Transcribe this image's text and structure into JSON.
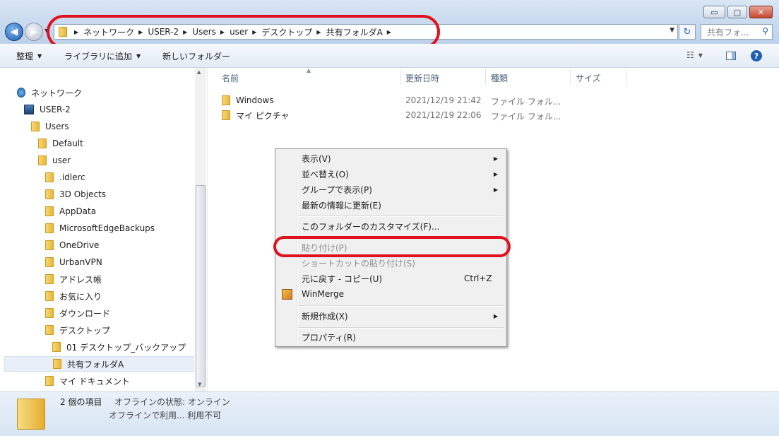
{
  "window": {
    "controls": {
      "minimize": "▭",
      "maximize": "□",
      "close": "✕"
    }
  },
  "address": {
    "breadcrumbs": [
      "ネットワーク",
      "USER-2",
      "Users",
      "user",
      "デスクトップ",
      "共有フォルダA"
    ],
    "search_placeholder": "共有フォ..."
  },
  "toolbar": {
    "organize": "整理",
    "add_to_library": "ライブラリに追加",
    "new_folder": "新しいフォルダー"
  },
  "sidebar": {
    "items": [
      {
        "label": "ネットワーク",
        "icon": "network-icon"
      },
      {
        "label": "USER-2",
        "icon": "computer-icon"
      },
      {
        "label": "Users",
        "icon": "user-folder-icon"
      },
      {
        "label": "Default",
        "icon": "folder-icon"
      },
      {
        "label": "user",
        "icon": "folder-icon"
      },
      {
        "label": ".idlerc",
        "icon": "folder-icon"
      },
      {
        "label": "3D Objects",
        "icon": "folder-icon"
      },
      {
        "label": "AppData",
        "icon": "folder-icon"
      },
      {
        "label": "MicrosoftEdgeBackups",
        "icon": "folder-icon"
      },
      {
        "label": "OneDrive",
        "icon": "folder-icon"
      },
      {
        "label": "UrbanVPN",
        "icon": "folder-icon"
      },
      {
        "label": "アドレス帳",
        "icon": "folder-icon"
      },
      {
        "label": "お気に入り",
        "icon": "favorites-folder-icon"
      },
      {
        "label": "ダウンロード",
        "icon": "downloads-folder-icon"
      },
      {
        "label": "デスクトップ",
        "icon": "desktop-folder-icon"
      },
      {
        "label": "01 デスクトップ_バックアップ",
        "icon": "folder-icon"
      },
      {
        "label": "共有フォルダA",
        "icon": "folder-icon",
        "selected": true
      },
      {
        "label": "マイ ドキュメント",
        "icon": "documents-folder-icon"
      }
    ]
  },
  "columns": {
    "name": "名前",
    "modified": "更新日時",
    "type": "種類",
    "size": "サイズ"
  },
  "files": [
    {
      "name": "Windows",
      "modified": "2021/12/19 21:42",
      "type": "ファイル フォル..."
    },
    {
      "name": "マイ ピクチャ",
      "modified": "2021/12/19 22:06",
      "type": "ファイル フォル..."
    }
  ],
  "context_menu": {
    "view": "表示(V)",
    "sort": "並べ替え(O)",
    "group": "グループで表示(P)",
    "refresh": "最新の情報に更新(E)",
    "customize": "このフォルダーのカスタマイズ(F)...",
    "paste": "貼り付け(P)",
    "paste_shortcut": "ショートカットの貼り付け(S)",
    "undo": "元に戻す - コピー(U)",
    "undo_shortcut": "Ctrl+Z",
    "winmerge": "WinMerge",
    "new": "新規作成(X)",
    "properties": "プロパティ(R)"
  },
  "status": {
    "count": "2 個の項目",
    "offline_status": "オフラインの状態: オンライン",
    "offline_availability": "オフラインで利用... 利用不可"
  },
  "colors": {
    "annotation": "#e0121e"
  }
}
